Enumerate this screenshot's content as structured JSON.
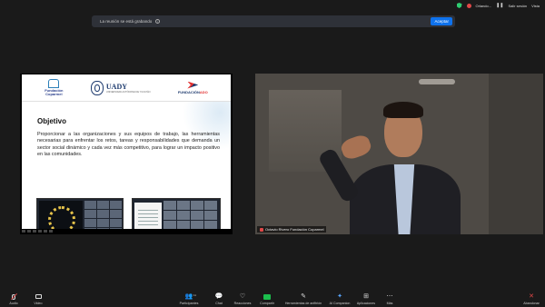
{
  "status": {
    "host_name": "Orlando...",
    "stop_label": "Salir sesión",
    "view_label": "Vista"
  },
  "banner": {
    "text": "La reunión se está grabando",
    "accept_label": "Aceptar"
  },
  "slide": {
    "logo_left_line1": "Fundación",
    "logo_left_line2": "Coparmel",
    "logo_center": "UADY",
    "logo_center_sub": "UNIVERSIDAD AUTÓNOMA DE YUCATÁN",
    "logo_right_prefix": "FUNDACIÓN",
    "logo_right_suffix": "ADO",
    "title": "Objetivo",
    "paragraph": "Proporcionar a las organizaciones y sus equipos de trabajo, las herramientas necesarias para enfrentar los retos, tareas y responsabilidades que demanda un sector social dinámico y cada vez más competitivo, para lograr un impacto positivo en las comunidades."
  },
  "participant": {
    "name": "Octavio Rivero Fundación Coparmel"
  },
  "toolbar": {
    "audio": "Audio",
    "video": "Video",
    "participants": "Participantes",
    "participants_count": "11",
    "chat": "Chat",
    "reactions": "Reacciones",
    "share": "Compartir",
    "whiteboard": "Herramientas de anfitrión",
    "ai": "AI Companion",
    "apps": "Aplicaciones",
    "more": "Más",
    "leave": "Abandonar"
  },
  "colors": {
    "accent": "#0e72ed",
    "share_green": "#1bbf4d",
    "record_red": "#e04848"
  }
}
